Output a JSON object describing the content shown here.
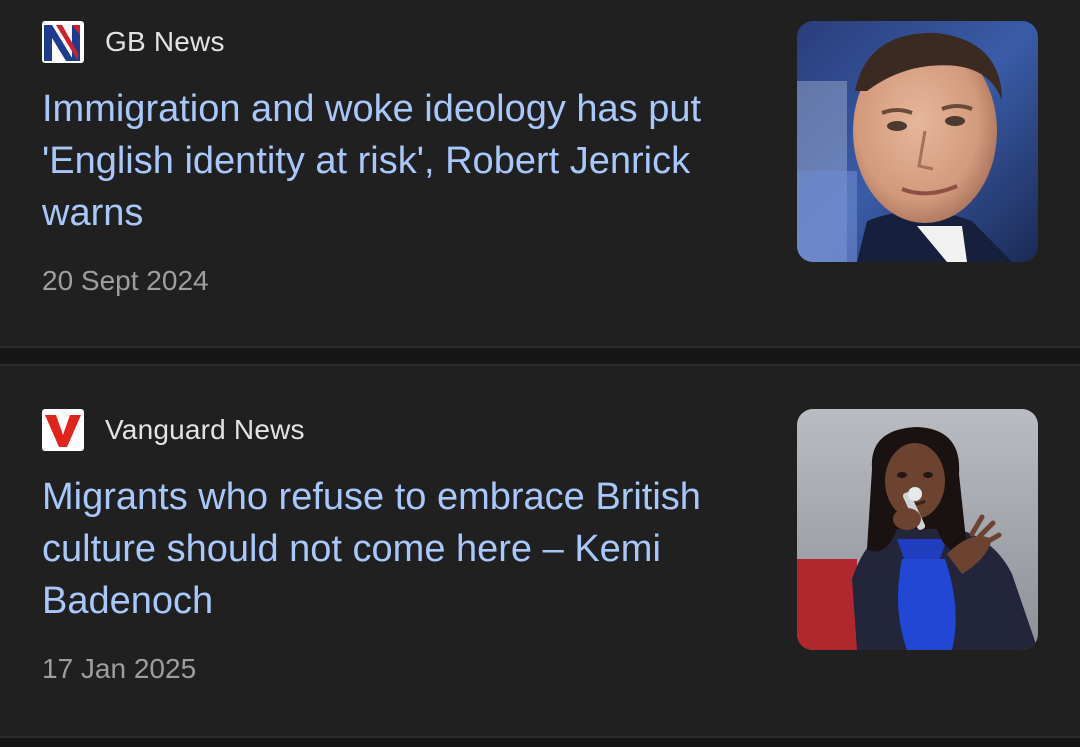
{
  "articles": [
    {
      "source": "GB News",
      "logo_icon": "gb-news-logo",
      "headline": "Immigration and woke ideology has put 'English identity at risk', Robert Jenrick warns",
      "date": "20 Sept 2024",
      "thumbnail": "man-in-suit-portrait"
    },
    {
      "source": "Vanguard News",
      "logo_icon": "vanguard-logo",
      "headline": "Migrants who refuse to embrace British culture should not come here – Kemi Badenoch",
      "date": "17 Jan 2025",
      "thumbnail": "woman-speaking-with-microphone"
    }
  ],
  "colors": {
    "background": "#1f1f1f",
    "headline": "#a8c7fa",
    "source_text": "#e3e3e3",
    "date_text": "#9e9e9e"
  }
}
